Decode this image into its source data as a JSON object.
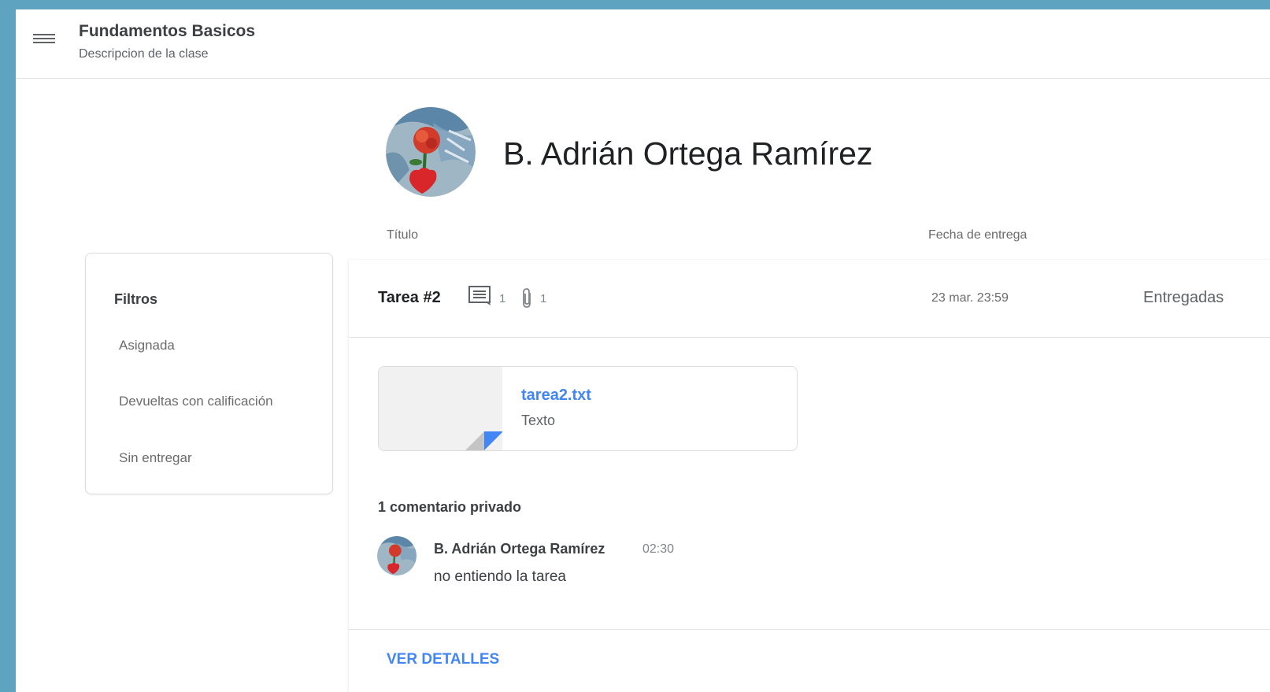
{
  "header": {
    "class_title": "Fundamentos Basicos",
    "class_description": "Descripcion de la clase"
  },
  "student": {
    "name": "B. Adrián Ortega Ramírez"
  },
  "columns": {
    "title": "Título",
    "due_date": "Fecha de entrega"
  },
  "filters": {
    "title": "Filtros",
    "items": [
      "Asignada",
      "Devueltas con calificación",
      "Sin entregar"
    ]
  },
  "assignment": {
    "title": "Tarea #2",
    "comment_count": "1",
    "attachment_count": "1",
    "due": "23 mar. 23:59",
    "status": "Entregadas",
    "file": {
      "name": "tarea2.txt",
      "type": "Texto"
    },
    "comments_heading": "1 comentario privado",
    "comment": {
      "author": "B. Adrián Ortega Ramírez",
      "time": "02:30",
      "text": "no entiendo la tarea"
    },
    "details_link": "VER DETALLES"
  },
  "colors": {
    "accent": "#4285f4",
    "frame": "#5ea3c0"
  },
  "icons": [
    "menu-icon",
    "comment-icon",
    "attachment-icon",
    "file-icon"
  ]
}
